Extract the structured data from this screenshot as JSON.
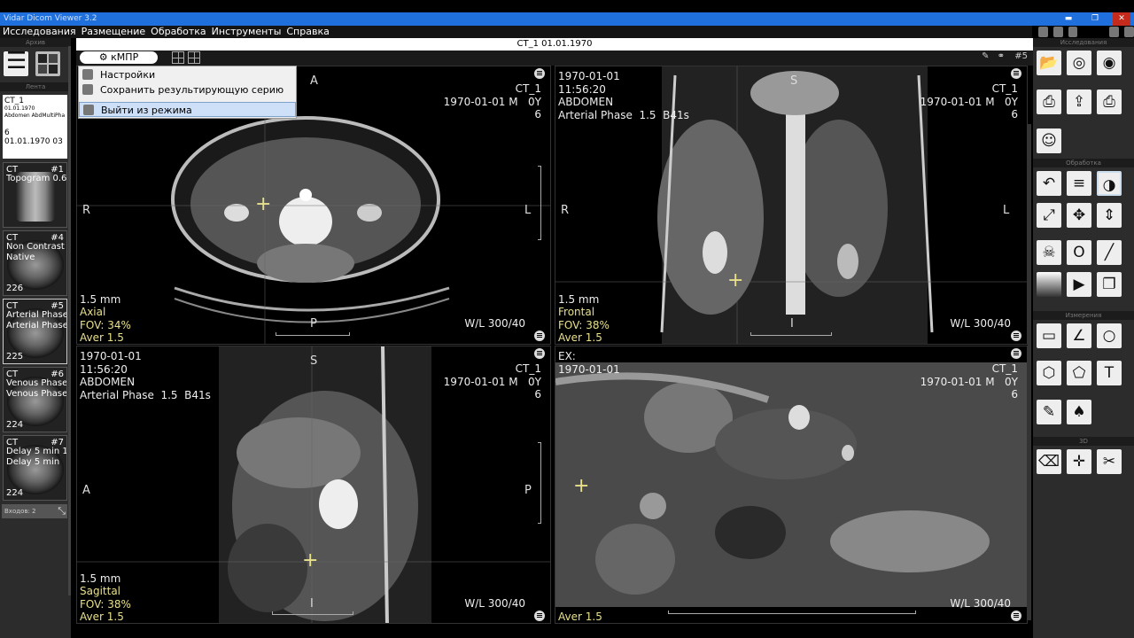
{
  "window": {
    "title": "Vidar Dicom Viewer 3.2"
  },
  "menu": [
    "Исследования",
    "Размещение",
    "Обработка",
    "Инструменты",
    "Справка"
  ],
  "study_header": "CT_1  01.01.1970",
  "left_panel": {
    "archive_label": "Архив",
    "tape_label": "Лента",
    "study": {
      "name": "CT_1",
      "date": "01.01.1970",
      "desc": "Abdomen AbdMultiPha",
      "count": "6",
      "datetime": "01.01.1970 03"
    },
    "series": [
      {
        "modality": "CT",
        "num": "#1",
        "line2": "Topogram  0.6",
        "line3": "",
        "count": ""
      },
      {
        "modality": "CT",
        "num": "#4",
        "line2": "Non Contrast",
        "line3": "Native",
        "count": "226"
      },
      {
        "modality": "CT",
        "num": "#5",
        "line2": "Arterial Phase",
        "line3": "Arterial Phase",
        "count": "225"
      },
      {
        "modality": "CT",
        "num": "#6",
        "line2": "Venous Phase",
        "line3": "Venous Phase",
        "count": "224"
      },
      {
        "modality": "CT",
        "num": "#7",
        "line2": "Delay 5 min  1",
        "line3": "Delay 5 min",
        "count": "224"
      }
    ],
    "footer": "Входов: 2"
  },
  "toolbar": {
    "mode_label": "кМПР",
    "series_num": "#5"
  },
  "context_menu": {
    "items": [
      "Настройки",
      "Сохранить результирующую серию",
      "Выйти из режима"
    ]
  },
  "viewports": {
    "axial": {
      "right_top": "CT_1\n1970-01-01 M   0Y\n6",
      "bottom_left_1": "1.5 mm",
      "bottom_left_yellow": "Axial\nFOV: 34%\nAver 1.5",
      "wl": "W/L 300/40",
      "orient": {
        "top": "A",
        "bottom": "P",
        "left": "R",
        "right": "L"
      }
    },
    "frontal": {
      "left_top": "1970-01-01\n11:56:20\nABDOMEN\nArterial Phase  1.5  B41s",
      "right_top": "CT_1\n1970-01-01 M   0Y\n6",
      "bottom_left_1": "1.5 mm",
      "bottom_left_yellow": "Frontal\nFOV: 38%\nAver 1.5",
      "wl": "W/L 300/40",
      "orient": {
        "top": "S",
        "bottom": "I",
        "left": "R",
        "right": "L"
      }
    },
    "sagittal": {
      "left_top": "1970-01-01\n11:56:20\nABDOMEN\nArterial Phase  1.5  B41s",
      "right_top": "CT_1\n1970-01-01 M   0Y\n6",
      "bottom_left_1": "1.5 mm",
      "bottom_left_yellow": "Sagittal\nFOV: 38%\nAver 1.5",
      "wl": "W/L 300/40",
      "orient": {
        "top": "S",
        "bottom": "I",
        "left": "A",
        "right": "P"
      }
    },
    "ex": {
      "left_top": "EX:\n1970-01-01",
      "right_top": "CT_1\n1970-01-01 M   0Y\n6",
      "bottom_left_yellow": "Aver 1.5",
      "wl": "W/L 300/40"
    }
  },
  "right_panel": {
    "sections": [
      "Исследования",
      "Обработка",
      "Измерения",
      "3D"
    ]
  }
}
